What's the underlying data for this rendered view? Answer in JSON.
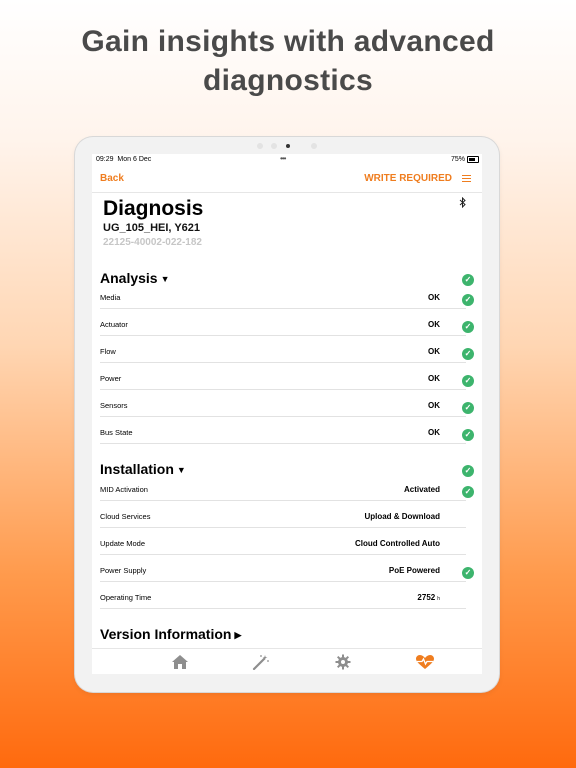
{
  "headline": {
    "line1": "Gain insights with advanced",
    "line2": "diagnostics"
  },
  "status_bar": {
    "time": "09:29",
    "date": "Mon 6 Dec",
    "battery": "75%"
  },
  "nav": {
    "back_label": "Back",
    "write_required_label": "WRITE REQUIRED"
  },
  "header": {
    "title": "Diagnosis",
    "device_name": "UG_105_HEI, Y621",
    "serial": "22125-40002-022-182"
  },
  "analysis": {
    "title": "Analysis",
    "rows": [
      {
        "label": "Media",
        "value": "OK"
      },
      {
        "label": "Actuator",
        "value": "OK"
      },
      {
        "label": "Flow",
        "value": "OK"
      },
      {
        "label": "Power",
        "value": "OK"
      },
      {
        "label": "Sensors",
        "value": "OK"
      },
      {
        "label": "Bus State",
        "value": "OK"
      }
    ]
  },
  "installation": {
    "title": "Installation",
    "rows": [
      {
        "label": "MID Activation",
        "value": "Activated"
      },
      {
        "label": "Cloud Services",
        "value": "Upload & Download"
      },
      {
        "label": "Update Mode",
        "value": "Cloud Controlled Auto"
      },
      {
        "label": "Power Supply",
        "value": "PoE Powered"
      },
      {
        "label": "Operating Time",
        "value": "2752",
        "unit": "h"
      }
    ]
  },
  "version": {
    "title": "Version Information"
  },
  "colors": {
    "accent": "#ef7d1f",
    "ok_green": "#3db46d",
    "tab_inactive": "#8e8e8e"
  },
  "icons": {
    "tabs": [
      "home-icon",
      "magic-wand-icon",
      "gear-icon",
      "heart-pulse-icon"
    ]
  }
}
